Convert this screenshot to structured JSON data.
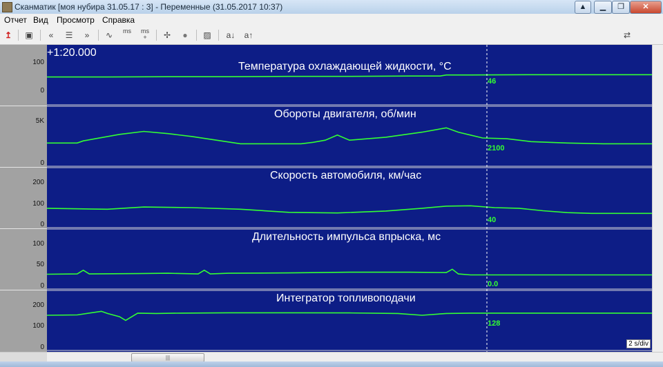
{
  "window": {
    "title": "Сканматик [моя нубира 31.05.17 : 3] - Переменные (31.05.2017  10:37)",
    "buttons": {
      "minimize": "▁",
      "maximize": "❐",
      "close": "✕"
    },
    "extra_button": "▲"
  },
  "menu": [
    "Отчет",
    "Вид",
    "Просмотр",
    "Справка"
  ],
  "toolbar": {
    "ms_label": "ms",
    "ms_plus": "+",
    "text_a_down": "a↓",
    "text_a_up": "a↑"
  },
  "time_readout": "+1:20.000",
  "scale_label": "2 s/div",
  "panels": [
    {
      "title": "Температура охлаждающей жидкости, °C",
      "ticks": [
        "100",
        "0"
      ],
      "readout": "46"
    },
    {
      "title": "Обороты двигателя, об/мин",
      "ticks": [
        "5K",
        "0"
      ],
      "readout": "2100"
    },
    {
      "title": "Скорость автомобиля, км/час",
      "ticks": [
        "200",
        "100",
        "0"
      ],
      "readout": "40"
    },
    {
      "title": "Длительность импульса впрыска, мс",
      "ticks": [
        "100",
        "50",
        "0"
      ],
      "readout": "0.0"
    },
    {
      "title": "Интегратор топливоподачи",
      "ticks": [
        "200",
        "100",
        "0"
      ],
      "readout": "128"
    }
  ],
  "colors": {
    "plot_bg": "#0d1d86",
    "trace": "#33ff33",
    "axis_bg": "#a2a2a2",
    "gridline": "#d8d8d8"
  },
  "chart_data": [
    {
      "type": "line",
      "title": "Температура охлаждающей жидкости, °C",
      "ylim": [
        0,
        130
      ],
      "x": [
        0,
        10,
        20,
        30,
        40,
        50,
        60,
        65,
        66,
        70,
        80,
        90,
        100
      ],
      "values": [
        42,
        42,
        43,
        43,
        44,
        44,
        45,
        45,
        48,
        48,
        49,
        49,
        49
      ]
    },
    {
      "type": "line",
      "title": "Обороты двигателя, об/мин",
      "ylim": [
        0,
        6000
      ],
      "x": [
        0,
        5,
        6,
        8,
        12,
        16,
        20,
        24,
        28,
        32,
        38,
        42,
        44,
        46,
        48,
        50,
        56,
        62,
        66,
        68,
        70,
        72,
        76,
        80,
        86,
        92,
        100
      ],
      "values": [
        1300,
        1300,
        1600,
        1900,
        2500,
        2900,
        2600,
        2200,
        1700,
        1200,
        1200,
        1200,
        1400,
        1700,
        2400,
        1700,
        2100,
        2800,
        3400,
        2800,
        2400,
        2000,
        1900,
        1500,
        1300,
        1200,
        1200
      ]
    },
    {
      "type": "line",
      "title": "Скорость автомобиля, км/час",
      "ylim": [
        0,
        280
      ],
      "x": [
        0,
        6,
        10,
        16,
        24,
        32,
        40,
        48,
        56,
        62,
        66,
        70,
        74,
        78,
        82,
        86,
        90,
        100
      ],
      "values": [
        36,
        32,
        30,
        44,
        40,
        30,
        10,
        6,
        18,
        36,
        50,
        52,
        40,
        36,
        20,
        8,
        3,
        3
      ]
    },
    {
      "type": "line",
      "title": "Длительность импульса впрыска, мс",
      "ylim": [
        0,
        130
      ],
      "x": [
        0,
        5,
        6,
        7,
        15,
        20,
        25,
        26,
        27,
        30,
        40,
        50,
        60,
        66,
        67,
        68,
        70,
        80,
        90,
        100
      ],
      "values": [
        3,
        4,
        15,
        4,
        5,
        6,
        4,
        15,
        4,
        6,
        7,
        9,
        9,
        8,
        18,
        4,
        1,
        1,
        1,
        1
      ]
    },
    {
      "type": "line",
      "title": "Интегратор топливоподачи",
      "ylim": [
        0,
        240
      ],
      "x": [
        0,
        5,
        9,
        10,
        12,
        13,
        15,
        18,
        22,
        30,
        40,
        50,
        58,
        62,
        66,
        70,
        74,
        80,
        90,
        100
      ],
      "values": [
        118,
        120,
        140,
        128,
        110,
        90,
        130,
        128,
        130,
        132,
        132,
        131,
        128,
        118,
        128,
        130,
        130,
        130,
        130,
        130
      ]
    }
  ]
}
